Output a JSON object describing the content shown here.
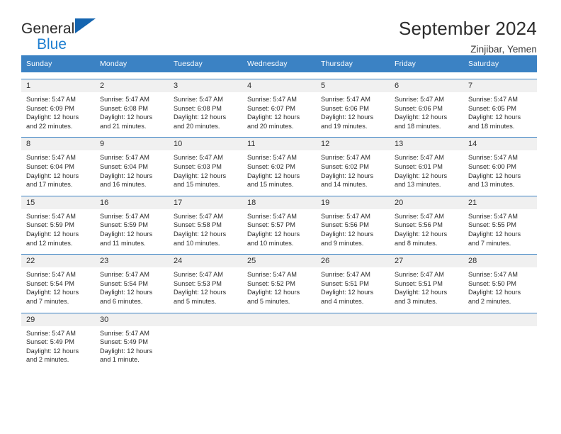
{
  "brand": {
    "line1": "General",
    "line2": "Blue",
    "triangle_icon": "blue-triangle-icon",
    "accent_dark_blue": "#1565b0",
    "accent_blue": "#1f7fd0"
  },
  "header": {
    "title": "September 2024",
    "subtitle": "Zinjibar, Yemen"
  },
  "theme": {
    "header_row_bg": "#3b82c4",
    "daynum_bg": "#f0f0f0",
    "row_divider": "#3b82c4",
    "text": "#2b2b2b"
  },
  "weekdays": [
    "Sunday",
    "Monday",
    "Tuesday",
    "Wednesday",
    "Thursday",
    "Friday",
    "Saturday"
  ],
  "labels": {
    "sunrise_prefix": "Sunrise:",
    "sunset_prefix": "Sunset:",
    "daylight_prefix": "Daylight:"
  },
  "weeks": [
    [
      {
        "day": "1",
        "sunrise": "Sunrise: 5:47 AM",
        "sunset": "Sunset: 6:09 PM",
        "daylight": "Daylight: 12 hours and 22 minutes.",
        "info": "Sunrise: 5:47 AM\nSunset: 6:09 PM\nDaylight: 12 hours and 22 minutes."
      },
      {
        "day": "2",
        "sunrise": "Sunrise: 5:47 AM",
        "sunset": "Sunset: 6:08 PM",
        "daylight": "Daylight: 12 hours and 21 minutes.",
        "info": "Sunrise: 5:47 AM\nSunset: 6:08 PM\nDaylight: 12 hours and 21 minutes."
      },
      {
        "day": "3",
        "sunrise": "Sunrise: 5:47 AM",
        "sunset": "Sunset: 6:08 PM",
        "daylight": "Daylight: 12 hours and 20 minutes.",
        "info": "Sunrise: 5:47 AM\nSunset: 6:08 PM\nDaylight: 12 hours and 20 minutes."
      },
      {
        "day": "4",
        "sunrise": "Sunrise: 5:47 AM",
        "sunset": "Sunset: 6:07 PM",
        "daylight": "Daylight: 12 hours and 20 minutes.",
        "info": "Sunrise: 5:47 AM\nSunset: 6:07 PM\nDaylight: 12 hours and 20 minutes."
      },
      {
        "day": "5",
        "sunrise": "Sunrise: 5:47 AM",
        "sunset": "Sunset: 6:06 PM",
        "daylight": "Daylight: 12 hours and 19 minutes.",
        "info": "Sunrise: 5:47 AM\nSunset: 6:06 PM\nDaylight: 12 hours and 19 minutes."
      },
      {
        "day": "6",
        "sunrise": "Sunrise: 5:47 AM",
        "sunset": "Sunset: 6:06 PM",
        "daylight": "Daylight: 12 hours and 18 minutes.",
        "info": "Sunrise: 5:47 AM\nSunset: 6:06 PM\nDaylight: 12 hours and 18 minutes."
      },
      {
        "day": "7",
        "sunrise": "Sunrise: 5:47 AM",
        "sunset": "Sunset: 6:05 PM",
        "daylight": "Daylight: 12 hours and 18 minutes.",
        "info": "Sunrise: 5:47 AM\nSunset: 6:05 PM\nDaylight: 12 hours and 18 minutes."
      }
    ],
    [
      {
        "day": "8",
        "sunrise": "Sunrise: 5:47 AM",
        "sunset": "Sunset: 6:04 PM",
        "daylight": "Daylight: 12 hours and 17 minutes.",
        "info": "Sunrise: 5:47 AM\nSunset: 6:04 PM\nDaylight: 12 hours and 17 minutes."
      },
      {
        "day": "9",
        "sunrise": "Sunrise: 5:47 AM",
        "sunset": "Sunset: 6:04 PM",
        "daylight": "Daylight: 12 hours and 16 minutes.",
        "info": "Sunrise: 5:47 AM\nSunset: 6:04 PM\nDaylight: 12 hours and 16 minutes."
      },
      {
        "day": "10",
        "sunrise": "Sunrise: 5:47 AM",
        "sunset": "Sunset: 6:03 PM",
        "daylight": "Daylight: 12 hours and 15 minutes.",
        "info": "Sunrise: 5:47 AM\nSunset: 6:03 PM\nDaylight: 12 hours and 15 minutes."
      },
      {
        "day": "11",
        "sunrise": "Sunrise: 5:47 AM",
        "sunset": "Sunset: 6:02 PM",
        "daylight": "Daylight: 12 hours and 15 minutes.",
        "info": "Sunrise: 5:47 AM\nSunset: 6:02 PM\nDaylight: 12 hours and 15 minutes."
      },
      {
        "day": "12",
        "sunrise": "Sunrise: 5:47 AM",
        "sunset": "Sunset: 6:02 PM",
        "daylight": "Daylight: 12 hours and 14 minutes.",
        "info": "Sunrise: 5:47 AM\nSunset: 6:02 PM\nDaylight: 12 hours and 14 minutes."
      },
      {
        "day": "13",
        "sunrise": "Sunrise: 5:47 AM",
        "sunset": "Sunset: 6:01 PM",
        "daylight": "Daylight: 12 hours and 13 minutes.",
        "info": "Sunrise: 5:47 AM\nSunset: 6:01 PM\nDaylight: 12 hours and 13 minutes."
      },
      {
        "day": "14",
        "sunrise": "Sunrise: 5:47 AM",
        "sunset": "Sunset: 6:00 PM",
        "daylight": "Daylight: 12 hours and 13 minutes.",
        "info": "Sunrise: 5:47 AM\nSunset: 6:00 PM\nDaylight: 12 hours and 13 minutes."
      }
    ],
    [
      {
        "day": "15",
        "sunrise": "Sunrise: 5:47 AM",
        "sunset": "Sunset: 5:59 PM",
        "daylight": "Daylight: 12 hours and 12 minutes.",
        "info": "Sunrise: 5:47 AM\nSunset: 5:59 PM\nDaylight: 12 hours and 12 minutes."
      },
      {
        "day": "16",
        "sunrise": "Sunrise: 5:47 AM",
        "sunset": "Sunset: 5:59 PM",
        "daylight": "Daylight: 12 hours and 11 minutes.",
        "info": "Sunrise: 5:47 AM\nSunset: 5:59 PM\nDaylight: 12 hours and 11 minutes."
      },
      {
        "day": "17",
        "sunrise": "Sunrise: 5:47 AM",
        "sunset": "Sunset: 5:58 PM",
        "daylight": "Daylight: 12 hours and 10 minutes.",
        "info": "Sunrise: 5:47 AM\nSunset: 5:58 PM\nDaylight: 12 hours and 10 minutes."
      },
      {
        "day": "18",
        "sunrise": "Sunrise: 5:47 AM",
        "sunset": "Sunset: 5:57 PM",
        "daylight": "Daylight: 12 hours and 10 minutes.",
        "info": "Sunrise: 5:47 AM\nSunset: 5:57 PM\nDaylight: 12 hours and 10 minutes."
      },
      {
        "day": "19",
        "sunrise": "Sunrise: 5:47 AM",
        "sunset": "Sunset: 5:56 PM",
        "daylight": "Daylight: 12 hours and 9 minutes.",
        "info": "Sunrise: 5:47 AM\nSunset: 5:56 PM\nDaylight: 12 hours and 9 minutes."
      },
      {
        "day": "20",
        "sunrise": "Sunrise: 5:47 AM",
        "sunset": "Sunset: 5:56 PM",
        "daylight": "Daylight: 12 hours and 8 minutes.",
        "info": "Sunrise: 5:47 AM\nSunset: 5:56 PM\nDaylight: 12 hours and 8 minutes."
      },
      {
        "day": "21",
        "sunrise": "Sunrise: 5:47 AM",
        "sunset": "Sunset: 5:55 PM",
        "daylight": "Daylight: 12 hours and 7 minutes.",
        "info": "Sunrise: 5:47 AM\nSunset: 5:55 PM\nDaylight: 12 hours and 7 minutes."
      }
    ],
    [
      {
        "day": "22",
        "sunrise": "Sunrise: 5:47 AM",
        "sunset": "Sunset: 5:54 PM",
        "daylight": "Daylight: 12 hours and 7 minutes.",
        "info": "Sunrise: 5:47 AM\nSunset: 5:54 PM\nDaylight: 12 hours and 7 minutes."
      },
      {
        "day": "23",
        "sunrise": "Sunrise: 5:47 AM",
        "sunset": "Sunset: 5:54 PM",
        "daylight": "Daylight: 12 hours and 6 minutes.",
        "info": "Sunrise: 5:47 AM\nSunset: 5:54 PM\nDaylight: 12 hours and 6 minutes."
      },
      {
        "day": "24",
        "sunrise": "Sunrise: 5:47 AM",
        "sunset": "Sunset: 5:53 PM",
        "daylight": "Daylight: 12 hours and 5 minutes.",
        "info": "Sunrise: 5:47 AM\nSunset: 5:53 PM\nDaylight: 12 hours and 5 minutes."
      },
      {
        "day": "25",
        "sunrise": "Sunrise: 5:47 AM",
        "sunset": "Sunset: 5:52 PM",
        "daylight": "Daylight: 12 hours and 5 minutes.",
        "info": "Sunrise: 5:47 AM\nSunset: 5:52 PM\nDaylight: 12 hours and 5 minutes."
      },
      {
        "day": "26",
        "sunrise": "Sunrise: 5:47 AM",
        "sunset": "Sunset: 5:51 PM",
        "daylight": "Daylight: 12 hours and 4 minutes.",
        "info": "Sunrise: 5:47 AM\nSunset: 5:51 PM\nDaylight: 12 hours and 4 minutes."
      },
      {
        "day": "27",
        "sunrise": "Sunrise: 5:47 AM",
        "sunset": "Sunset: 5:51 PM",
        "daylight": "Daylight: 12 hours and 3 minutes.",
        "info": "Sunrise: 5:47 AM\nSunset: 5:51 PM\nDaylight: 12 hours and 3 minutes."
      },
      {
        "day": "28",
        "sunrise": "Sunrise: 5:47 AM",
        "sunset": "Sunset: 5:50 PM",
        "daylight": "Daylight: 12 hours and 2 minutes.",
        "info": "Sunrise: 5:47 AM\nSunset: 5:50 PM\nDaylight: 12 hours and 2 minutes."
      }
    ],
    [
      {
        "day": "29",
        "sunrise": "Sunrise: 5:47 AM",
        "sunset": "Sunset: 5:49 PM",
        "daylight": "Daylight: 12 hours and 2 minutes.",
        "info": "Sunrise: 5:47 AM\nSunset: 5:49 PM\nDaylight: 12 hours and 2 minutes."
      },
      {
        "day": "30",
        "sunrise": "Sunrise: 5:47 AM",
        "sunset": "Sunset: 5:49 PM",
        "daylight": "Daylight: 12 hours and 1 minute.",
        "info": "Sunrise: 5:47 AM\nSunset: 5:49 PM\nDaylight: 12 hours and 1 minute."
      },
      {
        "day": "",
        "info": ""
      },
      {
        "day": "",
        "info": ""
      },
      {
        "day": "",
        "info": ""
      },
      {
        "day": "",
        "info": ""
      },
      {
        "day": "",
        "info": ""
      }
    ]
  ]
}
